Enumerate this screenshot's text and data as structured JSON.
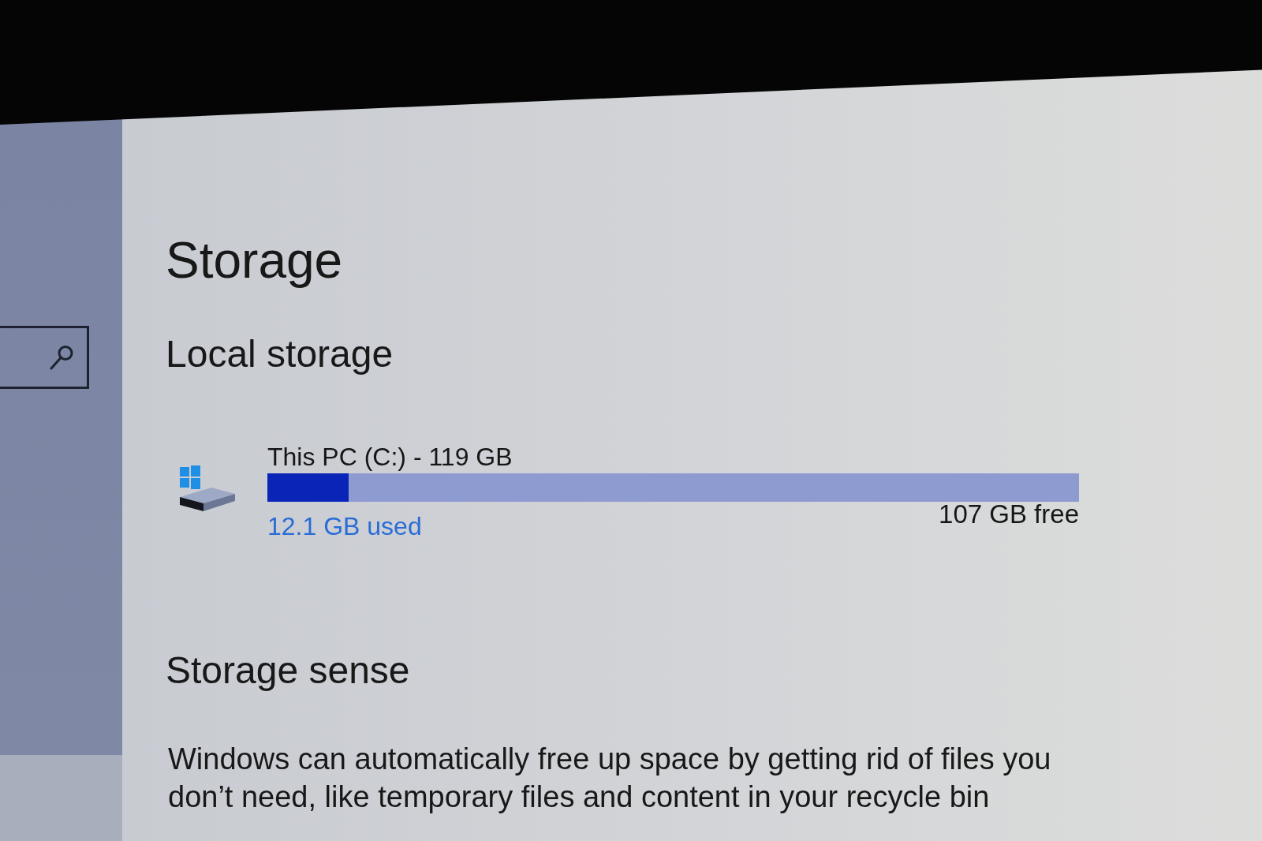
{
  "page": {
    "title": "Storage"
  },
  "local_storage": {
    "heading": "Local storage",
    "drives": [
      {
        "name": "This PC (C:) - 119 GB",
        "level": 0.1,
        "used": "12.1 GB used",
        "free": "107 GB free"
      }
    ]
  },
  "storage_sense": {
    "heading": "Storage sense",
    "description": "Windows can automatically free up space by getting rid of files you don’t need, like temporary files and content in your recycle bin"
  }
}
